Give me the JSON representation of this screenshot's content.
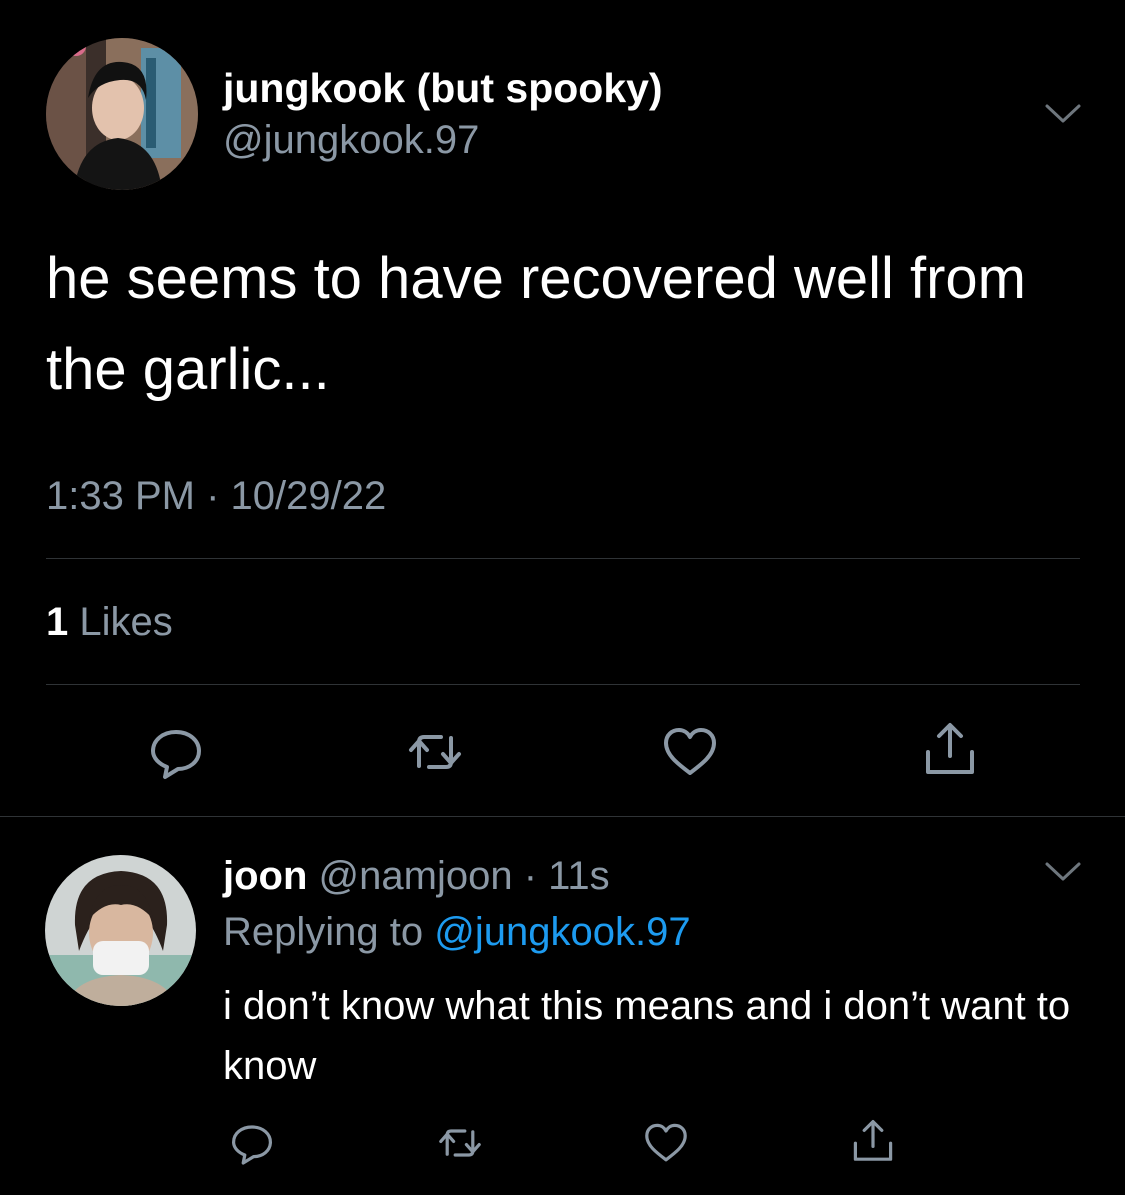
{
  "main_tweet": {
    "author": {
      "display_name": "jungkook (but spooky)",
      "handle": "@jungkook.97"
    },
    "text": "he seems to have recovered well from the garlic...",
    "timestamp": "1:33 PM · 10/29/22",
    "likes": {
      "count": "1",
      "label": " Likes"
    },
    "actions": [
      "reply-icon",
      "retweet-icon",
      "like-icon",
      "share-icon"
    ]
  },
  "reply_tweet": {
    "author": {
      "display_name": "joon",
      "handle": "@namjoon",
      "time": "· 11s"
    },
    "replying_to_label": "Replying to ",
    "replying_to_handle": "@jungkook.97",
    "text": "i don’t know what this means and i don’t want to know",
    "actions": [
      "reply-icon",
      "retweet-icon",
      "like-icon",
      "share-icon"
    ]
  },
  "colors": {
    "background": "#000000",
    "primary_text": "#ffffff",
    "secondary_text": "#8b98a5",
    "link": "#1d9bf0",
    "divider": "#2f3336"
  }
}
